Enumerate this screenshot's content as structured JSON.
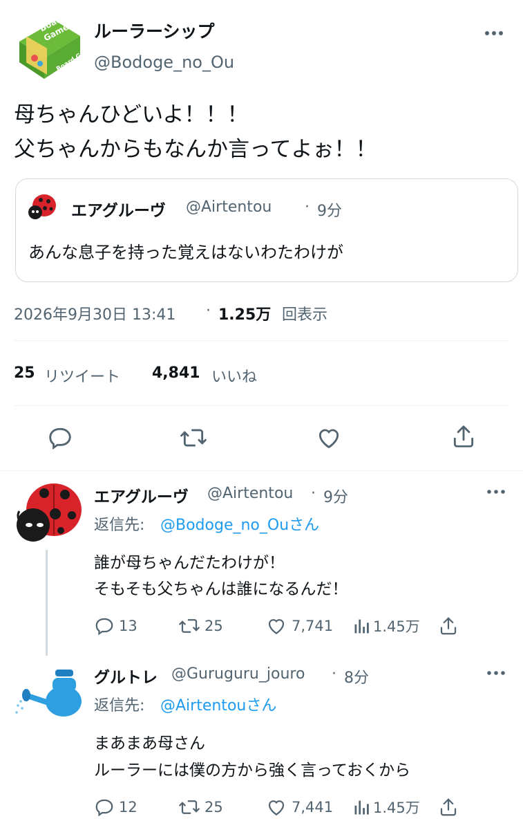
{
  "main_tweet": {
    "display_name": "ルーラーシップ",
    "handle": "@Bodoge_no_Ou",
    "text_line1": "母ちゃんひどいよ！！！",
    "text_line2": "父ちゃんからもなんか言ってよぉ！！",
    "avatar_label1": "Board",
    "avatar_label2": "Game",
    "avatar_label3": "Board Game",
    "quote": {
      "display_name": "エアグルーヴ",
      "handle": "@Airtentou",
      "separator": "·",
      "time": "9分",
      "text": "あんな息子を持った覚えはないわたわけが"
    },
    "timestamp": "2026年9月30日 13:41",
    "separator": "·",
    "views_count": "1.25万",
    "views_label": "回表示",
    "retweets_count": "25",
    "retweets_label": "リツイート",
    "likes_count": "4,841",
    "likes_label": "いいね"
  },
  "replies": [
    {
      "display_name": "エアグルーヴ",
      "handle": "@Airtentou",
      "separator": "·",
      "time": "9分",
      "reply_prefix": "返信先:",
      "reply_to": "@Bodoge_no_Ouさん",
      "text_line1": "誰が母ちゃんだたわけが！",
      "text_line2": "そもそも父ちゃんは誰になるんだ！",
      "replies": "13",
      "retweets": "25",
      "likes": "7,741",
      "views": "1.45万"
    },
    {
      "display_name": "グルトレ",
      "handle": "@Guruguru_jouro",
      "separator": "·",
      "time": "8分",
      "reply_prefix": "返信先:",
      "reply_to": "@Airtentouさん",
      "text_line1": "まあまあ母さん",
      "text_line2": "ルーラーには僕の方から強く言っておくから",
      "replies": "12",
      "retweets": "25",
      "likes": "7,441",
      "views": "1.45万"
    }
  ],
  "icons": {
    "more": "more-icon",
    "reply": "reply-icon",
    "retweet": "retweet-icon",
    "like": "like-icon",
    "share": "share-icon",
    "views": "views-icon"
  },
  "colors": {
    "text": "#0f1419",
    "secondary": "#536471",
    "accent": "#1d9bf0",
    "divider": "#eff3f4"
  }
}
